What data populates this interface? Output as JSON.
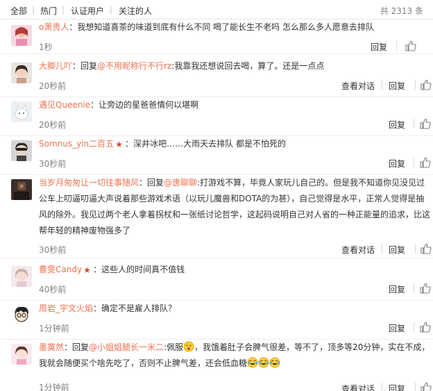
{
  "filters": {
    "all": "全部",
    "hot": "热门",
    "verified": "认证用户",
    "following": "关注的人",
    "total": "共 2313 条"
  },
  "actions": {
    "reply": "回复",
    "view_conversation": "查看对话"
  },
  "comments": [
    {
      "user": "o萧贵人",
      "sep": "：",
      "text": "我想知道喜茶的味道到底有什么不同 喝了能长生不老吗 怎么那么多人愿意去排队",
      "time": "1秒"
    },
    {
      "user": "大脚儿吖",
      "sep": "：",
      "pre": "回复",
      "mention": "@不用昵称行不行rz",
      "text": ":我靠我还想说回去喝，算了。还是一点点",
      "time": "20秒前"
    },
    {
      "user": "遇见Queenie",
      "sep": "：",
      "text": "让旁边的星爸爸情何以堪啊",
      "time": "20秒前"
    },
    {
      "user": "Somnus_yin二百五",
      "sep": "：",
      "text": "深井冰吧……大雨天去排队 都是不怕死的",
      "time": "30秒前"
    },
    {
      "user": "当岁月匆匆让一切往事随风",
      "sep": "：",
      "pre": "回复",
      "mention": "@唐聊聊",
      "text": ":打游戏不算，毕竟人家玩儿自己的。但是我不知道你见没见过公车上叨逼叨逼大声说着那些游戏术语（以玩儿魔兽和DOTA的为甚），自己觉得是水平，正常人觉得是抽风的除外。我见过两个老人拿着拐杖和一张纸讨论哲学，这起码说明自己对人省的一种正能量的追求，比这帮年轻的精神废物强多了",
      "time": "30秒前"
    },
    {
      "user": "曹雯Candy",
      "sep": "：",
      "text": "这些人的时间真不值钱",
      "time": "40秒前"
    },
    {
      "user": "周岩_宇文火焰",
      "sep": "：",
      "text": "确定不是雇人排队？",
      "time": "1分钟前"
    },
    {
      "user": "墨寞然",
      "sep": "：",
      "pre": "回复",
      "mention": "@小姐姐腿长一米二",
      "text_a": ":佩服",
      "text": "，我饿着肚子会脾气很差，等不了，顶多等20分钟，实在不成，我就会随便买个啥先吃了，否则不止脾气差，还会低血糖",
      "time": "1分钟前"
    }
  ],
  "colors": {
    "link": "#eb7350",
    "text": "#333333",
    "muted": "#808080",
    "vip": "#e0432b"
  }
}
